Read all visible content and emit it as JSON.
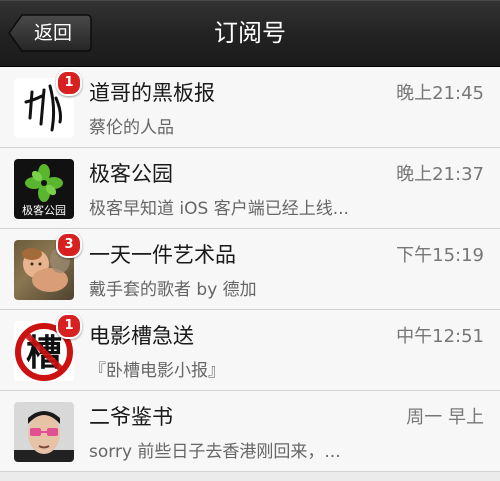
{
  "header": {
    "back_label": "返回",
    "title": "订阅号"
  },
  "items": [
    {
      "name": "道哥的黑板报",
      "time": "晚上21:45",
      "preview": "蔡伦的人品",
      "badge": "1"
    },
    {
      "name": "极客公园",
      "time": "晚上21:37",
      "preview": "极客早知道 iOS 客户端已经上线...",
      "badge": ""
    },
    {
      "name": "一天一件艺术品",
      "time": "下午15:19",
      "preview": "戴手套的歌者 by 德加",
      "badge": "3"
    },
    {
      "name": "电影槽急送",
      "time": "中午12:51",
      "preview": "『卧槽电影小报』",
      "badge": "1"
    },
    {
      "name": "二爷鉴书",
      "time": "周一 早上",
      "preview": "sorry 前些日子去香港刚回来，...",
      "badge": ""
    }
  ],
  "avatar_text": {
    "geekpark": "极客公园",
    "movie": "槽"
  },
  "colors": {
    "header_bg": "#222222",
    "badge": "#d72020",
    "geekpark_green": "#5ab52f"
  }
}
